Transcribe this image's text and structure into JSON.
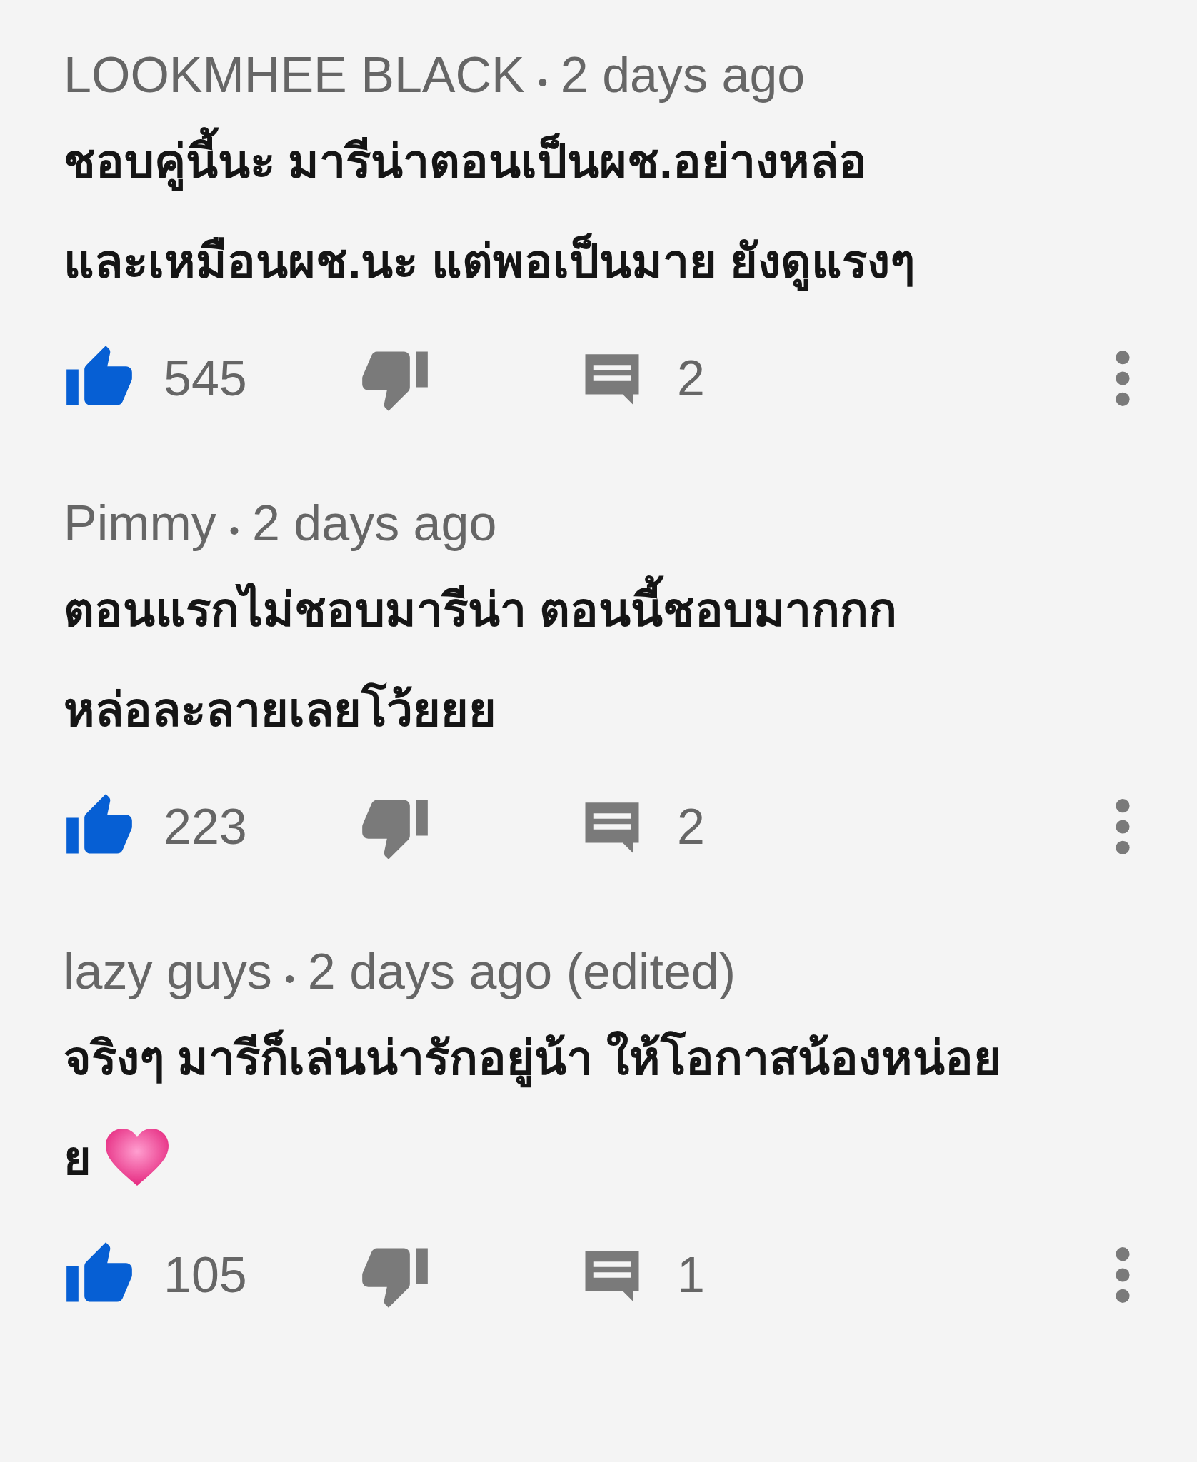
{
  "comments": [
    {
      "author": "LOOKMHEE BLACK",
      "separator": "•",
      "time": "2 days ago",
      "lines": [
        "ชอบคู่นี้นะ มารีน่าตอนเป็นผช.อย่างหล่อ",
        "และเหมือนผช.นะ แต่พอเป็นมาย ยังดูแรงๆ"
      ],
      "has_heart": false,
      "liked": true,
      "disliked": false,
      "likes": "545",
      "replies": "2"
    },
    {
      "author": "Pimmy",
      "separator": "•",
      "time": "2 days ago",
      "lines": [
        "ตอนแรกไม่ชอบมารีน่า ตอนนี้ชอบมากกก",
        "หล่อละลายเลยโว้ยยย"
      ],
      "has_heart": false,
      "liked": true,
      "disliked": false,
      "likes": "223",
      "replies": "2"
    },
    {
      "author": "lazy guys",
      "separator": "•",
      "time": "2 days ago (edited)",
      "lines": [
        "จริงๆ มารีก็เล่นน่ารักอยู่น้า  ให้โอกาสน้องหน่อย",
        "ย"
      ],
      "has_heart": true,
      "liked": true,
      "disliked": false,
      "likes": "105",
      "replies": "1"
    }
  ]
}
